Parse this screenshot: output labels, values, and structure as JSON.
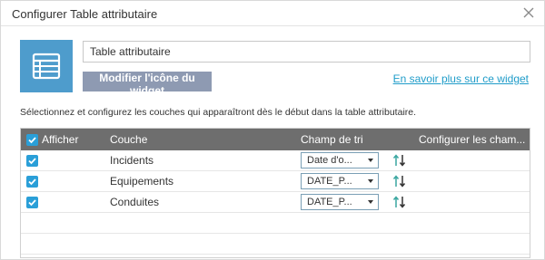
{
  "dialog": {
    "title": "Configurer Table attributaire"
  },
  "widget": {
    "name": "Table attributaire",
    "modify_icon_label": "Modifier l'icône du widget",
    "learn_more_label": "En savoir plus sur ce widget"
  },
  "description": "Sélectionnez et configurez les couches qui apparaîtront dès le début dans la table attributaire.",
  "table": {
    "headers": {
      "show": "Afficher",
      "layer": "Couche",
      "sort_field": "Champ de tri",
      "configure": "Configurer les cham..."
    },
    "rows": [
      {
        "checked": true,
        "layer": "Incidents",
        "sort": "Date d'o..."
      },
      {
        "checked": true,
        "layer": "Equipements",
        "sort": "DATE_P..."
      },
      {
        "checked": true,
        "layer": "Conduites",
        "sort": "DATE_P..."
      }
    ]
  },
  "colors": {
    "accent": "#2a9fd8",
    "header_bg": "#6e6e6e",
    "button_bg": "#8e9ab2",
    "icon_bg": "#4e9ccc",
    "link": "#1f9cc9",
    "sort_up": "#3aa6a0"
  },
  "icons": {
    "close": "close-icon",
    "widget": "table-list-icon",
    "checkbox": "checkmark-icon",
    "sort": "sort-arrows-icon",
    "dropdown": "chevron-down-icon"
  }
}
